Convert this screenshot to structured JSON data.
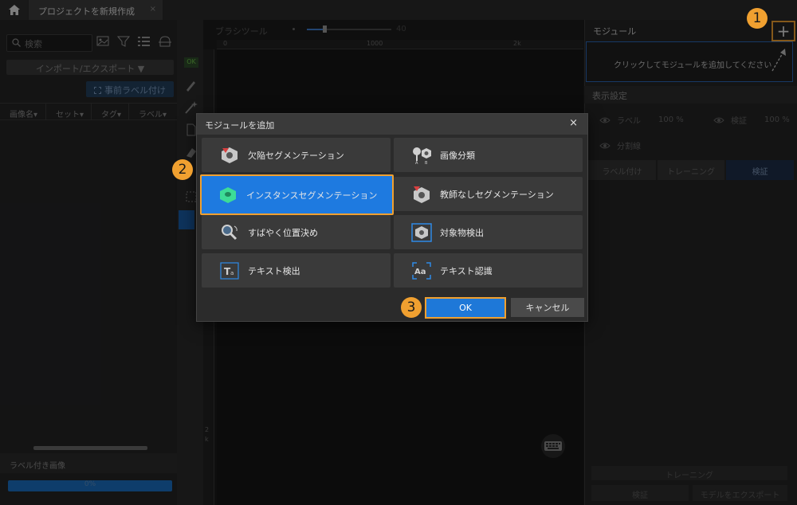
{
  "titlebar": {
    "home_icon": "home-icon",
    "tab_title": "プロジェクトを新規作成",
    "tab_close": "×"
  },
  "left": {
    "search_placeholder": "検索",
    "import_export_label": "インポート/エクスポート ▼",
    "prelabel_label": "事前ラベル付け",
    "columns": [
      "画像名▾",
      "セット▾",
      "タグ▾",
      "ラベル▾"
    ],
    "labeled_images": "ラベル付き画像",
    "progress_text": "0%",
    "progress_value": 1.0
  },
  "tools": {
    "ok_badge": "OK"
  },
  "canvas": {
    "brush_tool_label": "ブラシツール",
    "brush_size_value": "40",
    "ruler_ticks": [
      "0",
      "1000",
      "2k"
    ],
    "vruler_tick": "2 k"
  },
  "right": {
    "module_title": "モジュール",
    "add_button": "+",
    "module_hint": "クリックしてモジュールを追加してください",
    "display_settings": "表示設定",
    "label_toggle": "ラベル",
    "label_opacity": "100 %",
    "verify_toggle": "検証",
    "verify_opacity": "100 %",
    "split_line": "分割線",
    "tabs": [
      "ラベル付け",
      "トレーニング",
      "検証"
    ],
    "selected_tab": "検証",
    "train_button": "トレーニング",
    "verify_button": "検証",
    "export_button": "モデルをエクスポート"
  },
  "dialog": {
    "title": "モジュールを追加",
    "close": "×",
    "modules": [
      {
        "label": "欠陥セグメンテーション",
        "icon": "defect-segmentation-icon"
      },
      {
        "label": "画像分類",
        "icon": "image-classification-icon"
      },
      {
        "label": "インスタンスセグメンテーション",
        "icon": "instance-segmentation-icon",
        "selected": true
      },
      {
        "label": "教師なしセグメンテーション",
        "icon": "unsupervised-segmentation-icon"
      },
      {
        "label": "すばやく位置決め",
        "icon": "fast-positioning-icon"
      },
      {
        "label": "対象物検出",
        "icon": "object-detection-icon"
      },
      {
        "label": "テキスト検出",
        "icon": "text-detection-icon"
      },
      {
        "label": "テキスト認識",
        "icon": "text-recognition-icon"
      }
    ],
    "ok_button": "OK",
    "cancel_button": "キャンセル"
  },
  "steps": [
    "1",
    "2",
    "3"
  ],
  "colors": {
    "accent_blue": "#1e78d8",
    "highlight_orange": "#f0a030",
    "panel_dark": "#252526"
  }
}
